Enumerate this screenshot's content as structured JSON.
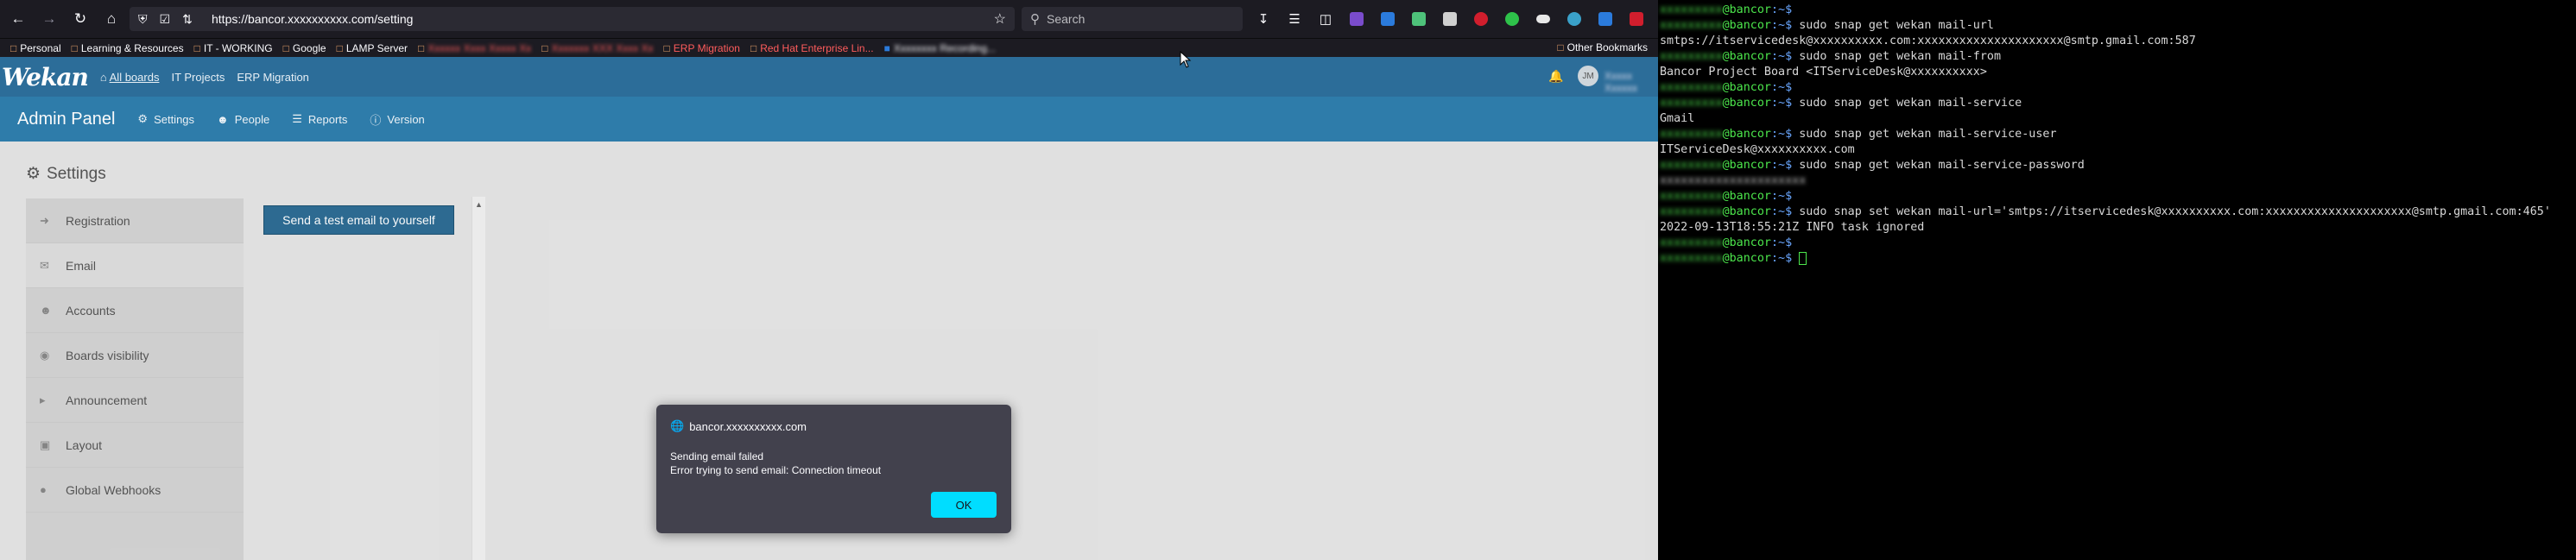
{
  "browser": {
    "url": "https://bancor.xxxxxxxxxx.com/setting",
    "search_placeholder": "Search",
    "bookmarks": [
      {
        "label": "Personal",
        "blurred": false
      },
      {
        "label": "Learning & Resources",
        "blurred": false
      },
      {
        "label": "IT - WORKING",
        "blurred": false
      },
      {
        "label": "Google",
        "blurred": false
      },
      {
        "label": "LAMP Server",
        "blurred": false
      },
      {
        "label": "Xxxxxx Xxxx Xxxxx Xx",
        "blurred": true
      },
      {
        "label": "Xxxxxxx XXX Xxxx Xx",
        "blurred": true
      },
      {
        "label": "ERP Migration",
        "blurred": false
      },
      {
        "label": "Red Hat Enterprise Lin...",
        "blurred": false
      },
      {
        "label": "Xxxxxxxx Recording...",
        "blurred": true
      }
    ],
    "other_bookmarks": "Other Bookmarks"
  },
  "wekan": {
    "logo": "Wekan",
    "nav": {
      "all_boards": "All boards",
      "it_projects": "IT Projects",
      "erp_migration": "ERP Migration"
    },
    "avatar_initials": "JM",
    "user_name": "Xxxxx Xxxxxx",
    "admin_title": "Admin Panel",
    "admin_links": {
      "settings": "Settings",
      "people": "People",
      "reports": "Reports",
      "version": "Version"
    },
    "settings_heading": "Settings",
    "menu": [
      {
        "label": "Registration",
        "icon": "sign-in-icon"
      },
      {
        "label": "Email",
        "icon": "envelope-icon"
      },
      {
        "label": "Accounts",
        "icon": "users-icon"
      },
      {
        "label": "Boards visibility",
        "icon": "eye-icon"
      },
      {
        "label": "Announcement",
        "icon": "bullhorn-icon"
      },
      {
        "label": "Layout",
        "icon": "object-group-icon"
      },
      {
        "label": "Global Webhooks",
        "icon": "globe-icon"
      }
    ],
    "active_menu": "Email",
    "test_email_button": "Send a test email to yourself"
  },
  "dialog": {
    "origin": "bancor.xxxxxxxxxx.com",
    "line1": "Sending email failed",
    "line2": "Error trying to send email: Connection timeout",
    "ok": "OK"
  },
  "terminal": {
    "prompt_user": "xxxxxxxxx",
    "prompt_host": "@bancor",
    "prompt_path": ":~$",
    "lines": [
      {
        "type": "prompt",
        "cmd": ""
      },
      {
        "type": "prompt",
        "cmd": " sudo snap get wekan mail-url"
      },
      {
        "type": "output",
        "text": "smtps://itservicedesk@xxxxxxxxxx.com:xxxxxxxxxxxxxxxxxxxxx@smtp.gmail.com:587"
      },
      {
        "type": "prompt",
        "cmd": " sudo snap get wekan mail-from"
      },
      {
        "type": "output",
        "text": "Bancor Project Board <ITServiceDesk@xxxxxxxxxx>"
      },
      {
        "type": "prompt",
        "cmd": ""
      },
      {
        "type": "prompt",
        "cmd": " sudo snap get wekan mail-service"
      },
      {
        "type": "output",
        "text": "Gmail"
      },
      {
        "type": "prompt",
        "cmd": " sudo snap get wekan mail-service-user"
      },
      {
        "type": "output",
        "text": "ITServiceDesk@xxxxxxxxxx.com"
      },
      {
        "type": "prompt",
        "cmd": " sudo snap get wekan mail-service-password"
      },
      {
        "type": "output",
        "text": "xxxxxxxxxxxxxxxxxxxxx"
      },
      {
        "type": "prompt",
        "cmd": ""
      },
      {
        "type": "prompt",
        "cmd": " sudo snap set wekan mail-url='smtps://itservicedesk@xxxxxxxxxx.com:xxxxxxxxxxxxxxxxxxxxx@smtp.gmail.com:465'"
      },
      {
        "type": "output",
        "text": "2022-09-13T18:55:21Z INFO task ignored"
      },
      {
        "type": "prompt",
        "cmd": ""
      },
      {
        "type": "prompt",
        "cmd": " ",
        "cursor": true
      }
    ]
  },
  "colors": {
    "wekan_header": "#2c6d99",
    "admin_bar": "#2f7fae",
    "dialog_ok": "#00ddff",
    "terminal_prompt": "#4ce64c",
    "terminal_path": "#6aa7ff"
  }
}
